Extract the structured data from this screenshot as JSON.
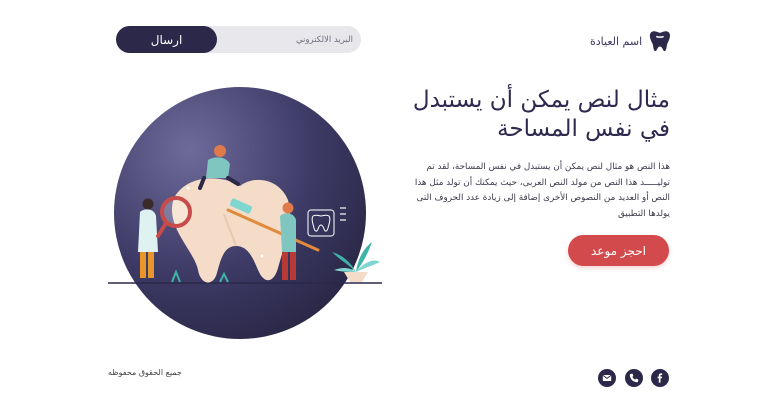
{
  "header": {
    "clinic_name": "اسم العيادة",
    "logo_icon": "tooth-icon",
    "email_placeholder": "البريد الالكتروني",
    "send_label": "ارسال"
  },
  "hero": {
    "title": "مثال لنص يمكن أن يستبدل في نفس المساحة",
    "description": "هذا النص هو مثال لنص يمكن أن يستبدل في نفس المساحة، لقد تم توليـــــد هذا النص من مولد النص العربى، حيث يمكنك أن تولد مثل هذا النص أو العديد من النصوص الأخرى إضافة إلى زيادة عدد الحروف التى يولدها التطبيق",
    "book_label": "احجز موعد"
  },
  "footer": {
    "copyright": "جميع الحقوق محفوظه",
    "social": [
      "facebook-icon",
      "phone-icon",
      "mail-icon"
    ]
  },
  "colors": {
    "primary_dark": "#2b2849",
    "accent_red": "#d24a4b",
    "input_bg": "#e8e8ec"
  }
}
